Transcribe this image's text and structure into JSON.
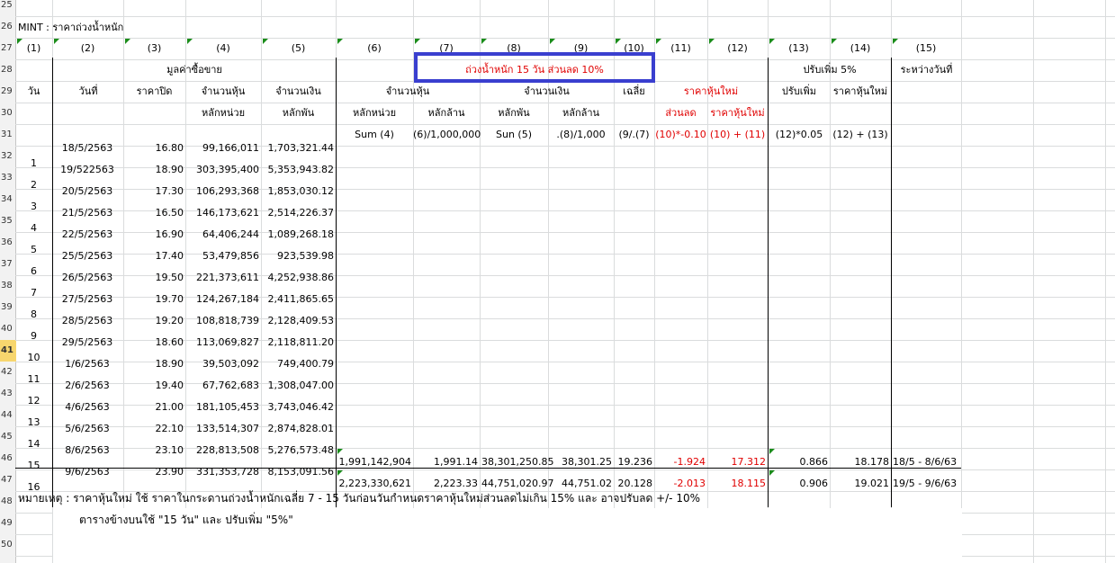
{
  "row_numbers": [
    "25",
    "26",
    "27",
    "28",
    "29",
    "30",
    "31",
    "32",
    "33",
    "34",
    "35",
    "36",
    "37",
    "38",
    "39",
    "40",
    "41",
    "42",
    "43",
    "44",
    "45",
    "46",
    "47",
    "48",
    "49",
    "50"
  ],
  "title": "MINT : ราคาถ่วงน้ำหนัก",
  "col_numbers": [
    "(1)",
    "(2)",
    "(3)",
    "(4)",
    "(5)",
    "(6)",
    "(7)",
    "(8)",
    "(9)",
    "(10)",
    "(11)",
    "(12)",
    "(13)",
    "(14)",
    "(15)"
  ],
  "headers": {
    "trade_value": "มูลค่าซื้อขาย",
    "weighted": "ถ่วงน้ำหนัก   15 วัน   ส่วนลด   10%",
    "adjust_up": "ปรับเพิ่ม   5%",
    "between_dates": "ระหว่างวันที่",
    "day": "วัน",
    "date": "วันที่",
    "close": "ราคาปิด",
    "shares": "จำนวนหุ้น",
    "money": "จำนวนเงิน",
    "shares2": "จำนวนหุ้น",
    "money2": "จำนวนเงิน",
    "avg": "เฉลี่ย",
    "new_price": "ราคาหุ้นใหม่",
    "adjust": "ปรับเพิ่ม",
    "new_price2": "ราคาหุ้นใหม่",
    "unit": "หลักหน่วย",
    "thousand": "หลักพัน",
    "unit2": "หลักหน่วย",
    "million": "หลักล้าน",
    "thousand2": "หลักพัน",
    "million2": "หลักล้าน",
    "discount": "ส่วนลด",
    "new_price3": "ราคาหุ้นใหม่",
    "f6": "Sum (4)",
    "f7": "(6)/1,000,000",
    "f8": "Sun (5)",
    "f9": ".(8)/1,000",
    "f10": "(9/.(7)",
    "f11": "(10)*-0.10",
    "f12": "(10) + (11)",
    "f13": "(12)*0.05",
    "f14": "(12) + (13)"
  },
  "rows": [
    {
      "day": "1",
      "date": "18/5/2563",
      "close": "16.80",
      "shares": "99,166,011",
      "money": "1,703,321.44"
    },
    {
      "day": "2",
      "date": "19/522563",
      "close": "18.90",
      "shares": "303,395,400",
      "money": "5,353,943.82"
    },
    {
      "day": "3",
      "date": "20/5/2563",
      "close": "17.30",
      "shares": "106,293,368",
      "money": "1,853,030.12"
    },
    {
      "day": "4",
      "date": "21/5/2563",
      "close": "16.50",
      "shares": "146,173,621",
      "money": "2,514,226.37"
    },
    {
      "day": "5",
      "date": "22/5/2563",
      "close": "16.90",
      "shares": "64,406,244",
      "money": "1,089,268.18"
    },
    {
      "day": "6",
      "date": "25/5/2563",
      "close": "17.40",
      "shares": "53,479,856",
      "money": "923,539.98"
    },
    {
      "day": "7",
      "date": "26/5/2563",
      "close": "19.50",
      "shares": "221,373,611",
      "money": "4,252,938.86"
    },
    {
      "day": "8",
      "date": "27/5/2563",
      "close": "19.70",
      "shares": "124,267,184",
      "money": "2,411,865.65"
    },
    {
      "day": "9",
      "date": "28/5/2563",
      "close": "19.20",
      "shares": "108,818,739",
      "money": "2,128,409.53"
    },
    {
      "day": "10",
      "date": "29/5/2563",
      "close": "18.60",
      "shares": "113,069,827",
      "money": "2,118,811.20"
    },
    {
      "day": "11",
      "date": "1/6/2563",
      "close": "18.90",
      "shares": "39,503,092",
      "money": "749,400.79"
    },
    {
      "day": "12",
      "date": "2/6/2563",
      "close": "19.40",
      "shares": "67,762,683",
      "money": "1,308,047.00"
    },
    {
      "day": "13",
      "date": "4/6/2563",
      "close": "21.00",
      "shares": "181,105,453",
      "money": "3,743,046.42"
    },
    {
      "day": "14",
      "date": "5/6/2563",
      "close": "22.10",
      "shares": "133,514,307",
      "money": "2,874,828.01"
    },
    {
      "day": "15",
      "date": "8/6/2563",
      "close": "23.10",
      "shares": "228,813,508",
      "money": "5,276,573.48"
    },
    {
      "day": "16",
      "date": "9/6/2563",
      "close": "23.90",
      "shares": "331,353,728",
      "money": "8,153,091.56"
    }
  ],
  "result_rows": [
    {
      "c6": "1,991,142,904",
      "c7": "1,991.14",
      "c8": "38,301,250.85",
      "c9": "38,301.25",
      "c10": "19.236",
      "c11": "-1.924",
      "c12": "17.312",
      "c13": "0.866",
      "c14": "18.178",
      "c15": "18/5 - 8/6/63"
    },
    {
      "c6": "2,223,330,621",
      "c7": "2,223.33",
      "c8": "44,751,020.97",
      "c9": "44,751.02",
      "c10": "20.128",
      "c11": "-2.013",
      "c12": "18.115",
      "c13": "0.906",
      "c14": "19.021",
      "c15": "19/5 - 9/6/63"
    }
  ],
  "notes": {
    "line1": "หมายเหตุ : ราคาหุ้นใหม่ ใช้ ราคาในกระดานถ่วงน้ำหนักเฉลี่ย 7 - 15 วันก่อนวันกำหนดราคาหุ้นใหม่ส่วนลดไม่เกิน 15% และ อาจปรับลด +/- 10%",
    "line2": "ตารางข้างบนใช้ \"15 วัน\" และ ปรับเพิ่ม \"5%\""
  },
  "colors": {
    "red": "#e00000",
    "highlight_box": "#3a3fcf",
    "selected_row": "#f7d66e"
  }
}
